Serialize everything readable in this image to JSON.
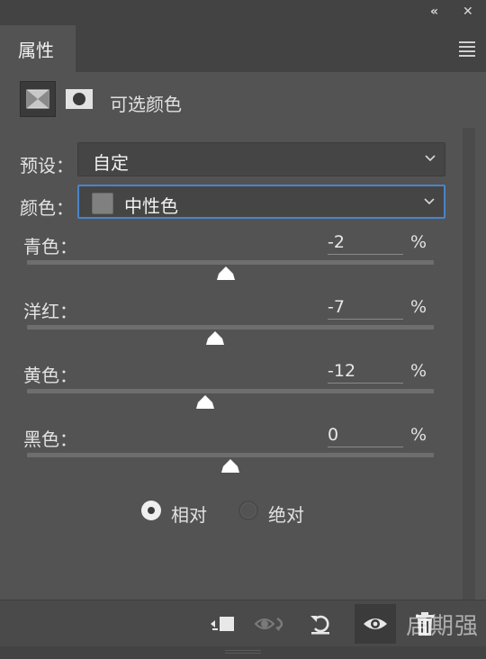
{
  "titlebar": {
    "collapse_icon": "«",
    "close_icon": "✕"
  },
  "tab": {
    "label": "属性"
  },
  "header": {
    "title": "可选颜色",
    "icons": [
      "adjustment-layer-icon",
      "layer-mask-icon"
    ]
  },
  "preset": {
    "label": "预设：",
    "value": "自定"
  },
  "colors": {
    "label": "颜色：",
    "value": "中性色",
    "swatch": "#808080"
  },
  "sliders": [
    {
      "label": "青色：",
      "value": "-2",
      "unit": "%"
    },
    {
      "label": "洋红：",
      "value": "-7",
      "unit": "%"
    },
    {
      "label": "黄色：",
      "value": "-12",
      "unit": "%"
    },
    {
      "label": "黑色：",
      "value": "0",
      "unit": "%"
    }
  ],
  "method": {
    "relative": "相对",
    "absolute": "绝对",
    "selected": "relative"
  },
  "footer": {
    "icons": [
      "clip-to-layer-icon",
      "view-previous-state-icon",
      "reset-icon",
      "visibility-icon",
      "delete-icon"
    ]
  },
  "watermark": "启期强",
  "accent": "#4a84c9"
}
